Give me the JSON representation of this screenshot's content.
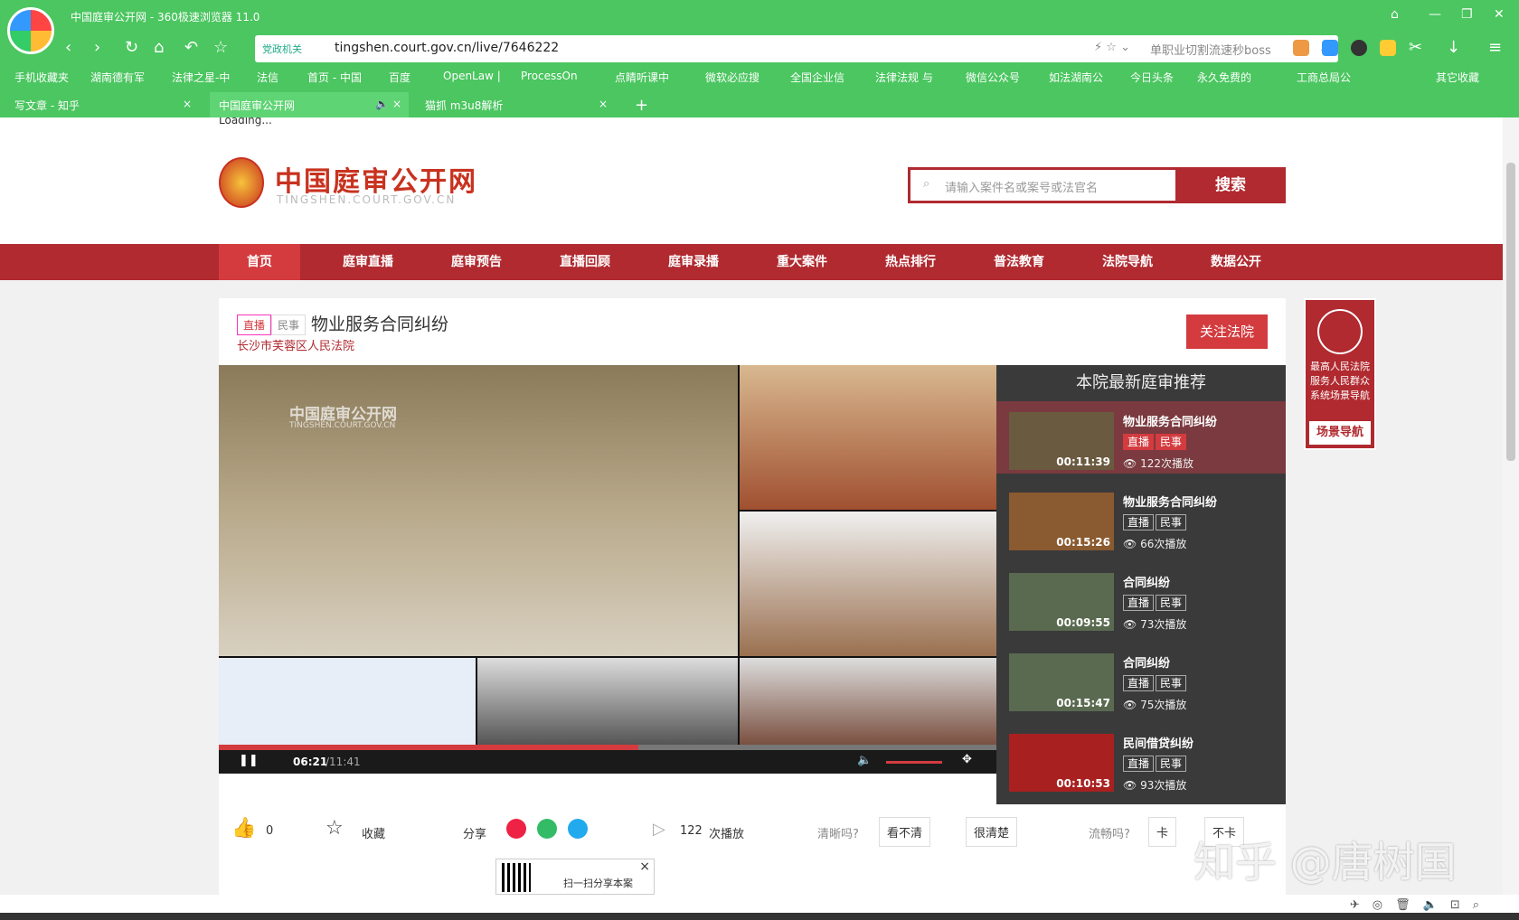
{
  "browser": {
    "window_title": "中国庭审公开网 - 360极速浏览器 11.0",
    "address": {
      "badge": "党政机关",
      "url": "tingshen.court.gov.cn/live/7646222",
      "search_hint": "单职业切割流速秒boss"
    },
    "bookmarks": [
      "手机收藏夹",
      "湖南德有军",
      "法律之星-中",
      "法信",
      "首页 - 中国",
      "百度",
      "OpenLaw |",
      "ProcessOn",
      "点睛听课中",
      "微软必应搜",
      "全国企业信",
      "法律法规 与",
      "微信公众号",
      "如法湖南公",
      "今日头条",
      "永久免费的",
      "工商总局公",
      "其它收藏"
    ],
    "tabs": [
      {
        "label": "写文章 - 知乎"
      },
      {
        "label": "中国庭审公开网"
      },
      {
        "label": "猫抓 m3u8解析"
      }
    ],
    "top_loading": "Loading..."
  },
  "site": {
    "name": "中国庭审公开网",
    "sub": "TINGSHEN.COURT.GOV.CN",
    "search_placeholder": "请输入案件名或案号或法官名",
    "search_button": "搜索",
    "nav": [
      "首页",
      "庭审直播",
      "庭审预告",
      "直播回顾",
      "庭审录播",
      "重大案件",
      "热点排行",
      "普法教育",
      "法院导航",
      "数据公开"
    ]
  },
  "case": {
    "tag_live": "直播",
    "tag_type": "民事",
    "title": "物业服务合同纠纷",
    "court": "长沙市芙蓉区人民法院",
    "follow": "关注法院",
    "time_current": "06:21",
    "time_total": "/11:41",
    "progress": 0.54,
    "video_watermark": "中国庭审公开网",
    "video_watermark_sub": "TINGSHEN.COURT.GOV.CN"
  },
  "reco": {
    "title": "本院最新庭审推荐",
    "items": [
      {
        "title": "物业服务合同纠纷",
        "tag1": "直播",
        "tag2": "民事",
        "duration": "00:11:39",
        "plays": "122次播放"
      },
      {
        "title": "物业服务合同纠纷",
        "tag1": "直播",
        "tag2": "民事",
        "duration": "00:15:26",
        "plays": "66次播放"
      },
      {
        "title": "合同纠纷",
        "tag1": "直播",
        "tag2": "民事",
        "duration": "00:09:55",
        "plays": "73次播放"
      },
      {
        "title": "合同纠纷",
        "tag1": "直播",
        "tag2": "民事",
        "duration": "00:15:47",
        "plays": "75次播放"
      },
      {
        "title": "民间借贷纠纷",
        "tag1": "直播",
        "tag2": "民事",
        "duration": "00:10:53",
        "plays": "93次播放"
      }
    ]
  },
  "side_ad": {
    "text": "最高人民法院服务人民群众系统场景导航",
    "button": "场景导航"
  },
  "actions": {
    "like_count": "0",
    "collect": "收藏",
    "share": "分享",
    "plays": "122",
    "plays_unit": "次播放",
    "clear_q": "清晰吗?",
    "not_clear": "看不清",
    "very_clear": "很清楚",
    "smooth_q": "流畅吗?",
    "stuck": "卡",
    "not_stuck": "不卡",
    "qr_text": "扫一扫分享本案"
  },
  "watermark": "知乎 @唐树国"
}
